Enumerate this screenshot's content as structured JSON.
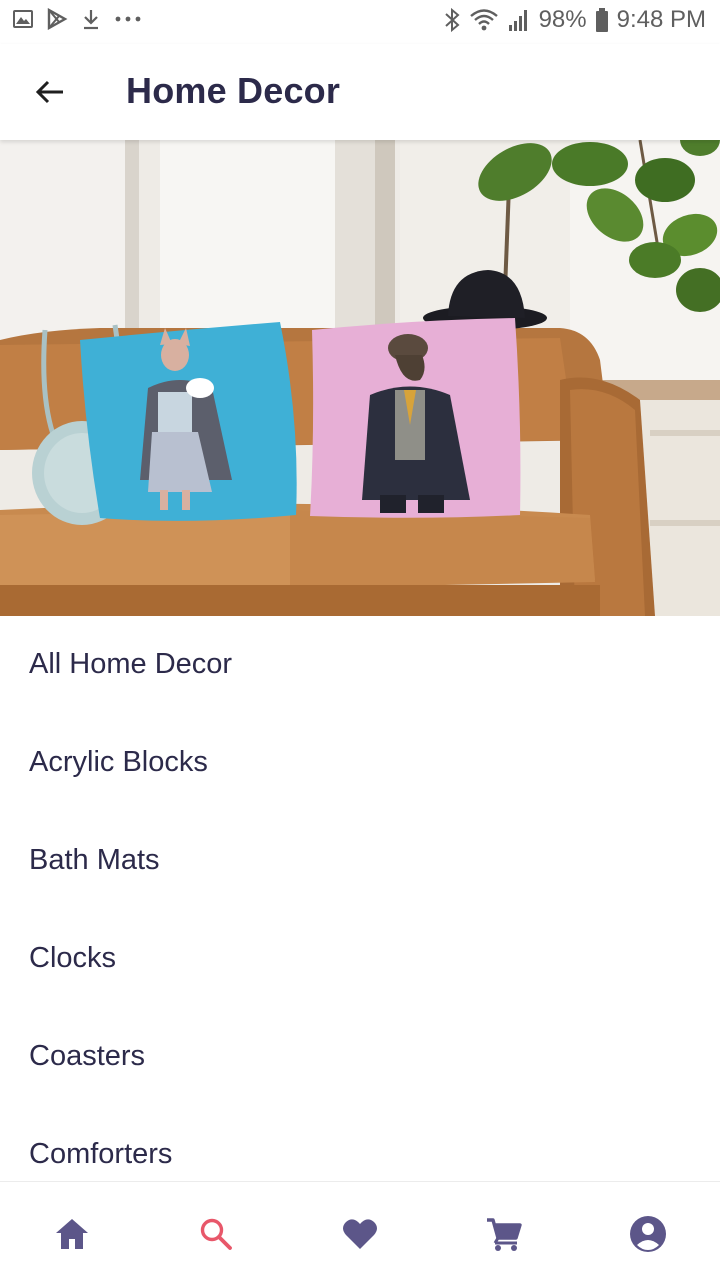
{
  "status_bar": {
    "battery": "98%",
    "time": "9:48 PM",
    "left_icons": [
      "image-icon",
      "play-store-icon",
      "download-icon",
      "more-dots-icon"
    ],
    "right_icons": [
      "bluetooth-icon",
      "wifi-icon",
      "signal-icon",
      "battery-icon"
    ]
  },
  "header": {
    "title": "Home Decor",
    "back_icon": "arrow-left-icon"
  },
  "hero": {
    "image": "banner-image"
  },
  "categories": [
    {
      "label": "All Home Decor"
    },
    {
      "label": "Acrylic Blocks"
    },
    {
      "label": "Bath Mats"
    },
    {
      "label": "Clocks"
    },
    {
      "label": "Coasters"
    },
    {
      "label": "Comforters"
    }
  ],
  "bottom_nav": {
    "items": [
      {
        "icon": "home-icon",
        "active": false
      },
      {
        "icon": "search-icon",
        "active": true
      },
      {
        "icon": "heart-icon",
        "active": false
      },
      {
        "icon": "cart-icon",
        "active": false
      },
      {
        "icon": "account-icon",
        "active": false
      }
    ]
  },
  "colors": {
    "primary_text": "#2c2a4a",
    "nav_icon": "#5c5689",
    "nav_active": "#e8576a",
    "status_gray": "#5f5f5f"
  }
}
